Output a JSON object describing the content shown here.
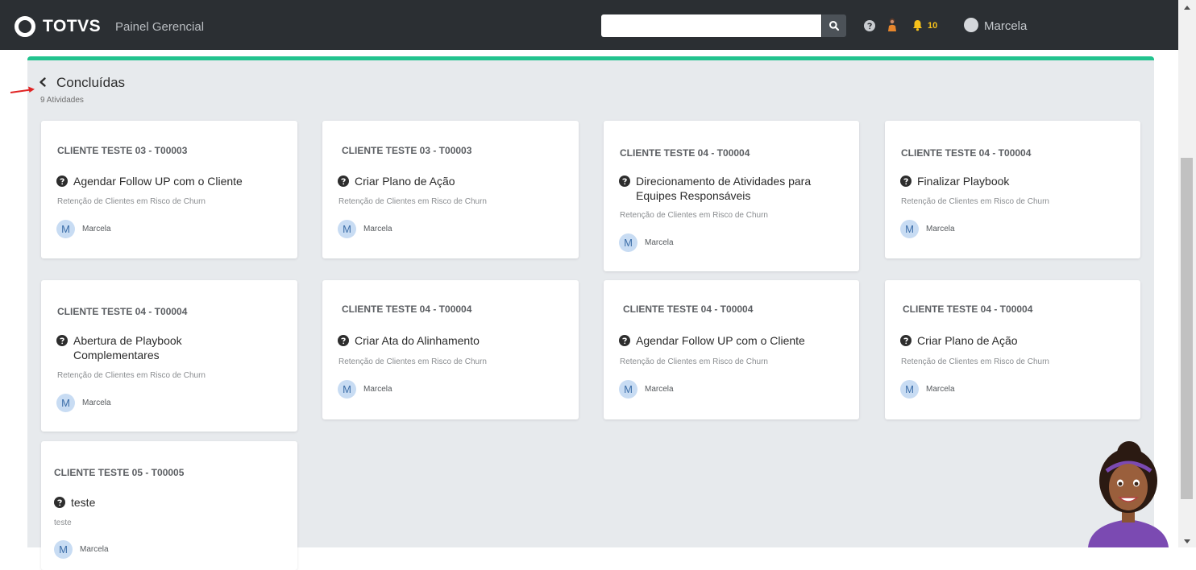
{
  "header": {
    "brand": "TOTVS",
    "subtitle": "Painel Gerencial",
    "search_value": "",
    "notification_count": "10",
    "user_name": "Marcela"
  },
  "page": {
    "title": "Concluídas",
    "subtitle": "9 Atividades"
  },
  "cards": [
    {
      "client": "CLIENTE TESTE 03 - T00003",
      "task": "Agendar Follow UP com o Cliente",
      "desc": "Retenção de Clientes em Risco de Churn",
      "avatar": "M",
      "user": "Marcela"
    },
    {
      "client": "CLIENTE TESTE 03 - T00003",
      "task": "Criar Plano de Ação",
      "desc": "Retenção de Clientes em Risco de Churn",
      "avatar": "M",
      "user": "Marcela"
    },
    {
      "client": "CLIENTE TESTE 04 - T00004",
      "task": "Direcionamento de Atividades para Equipes Responsáveis",
      "desc": "Retenção de Clientes em Risco de Churn",
      "avatar": "M",
      "user": "Marcela"
    },
    {
      "client": "CLIENTE TESTE 04 - T00004",
      "task": "Finalizar Playbook",
      "desc": "Retenção de Clientes em Risco de Churn",
      "avatar": "M",
      "user": "Marcela"
    },
    {
      "client": "CLIENTE TESTE 04 - T00004",
      "task": "Abertura de Playbook Complementares",
      "desc": "Retenção de Clientes em Risco de Churn",
      "avatar": "M",
      "user": "Marcela"
    },
    {
      "client": "CLIENTE TESTE 04 - T00004",
      "task": "Criar Ata do Alinhamento",
      "desc": "Retenção de Clientes em Risco de Churn",
      "avatar": "M",
      "user": "Marcela"
    },
    {
      "client": "CLIENTE TESTE 04 - T00004",
      "task": "Agendar Follow UP com o Cliente",
      "desc": "Retenção de Clientes em Risco de Churn",
      "avatar": "M",
      "user": "Marcela"
    },
    {
      "client": "CLIENTE TESTE 04 - T00004",
      "task": "Criar Plano de Ação",
      "desc": "Retenção de Clientes em Risco de Churn",
      "avatar": "M",
      "user": "Marcela"
    },
    {
      "client": "CLIENTE TESTE 05 - T00005",
      "task": "teste",
      "desc": "teste",
      "avatar": "M",
      "user": "Marcela"
    }
  ],
  "colors": {
    "topbar": "#2b2f33",
    "accent": "#22c38e",
    "panel": "#e7eaed",
    "notification": "#f7c21b"
  },
  "icons": [
    "totvs-logo-icon",
    "search-icon",
    "help-icon",
    "person-icon",
    "bell-icon",
    "user-avatar-icon",
    "back-chevron-icon",
    "question-circle-icon"
  ]
}
